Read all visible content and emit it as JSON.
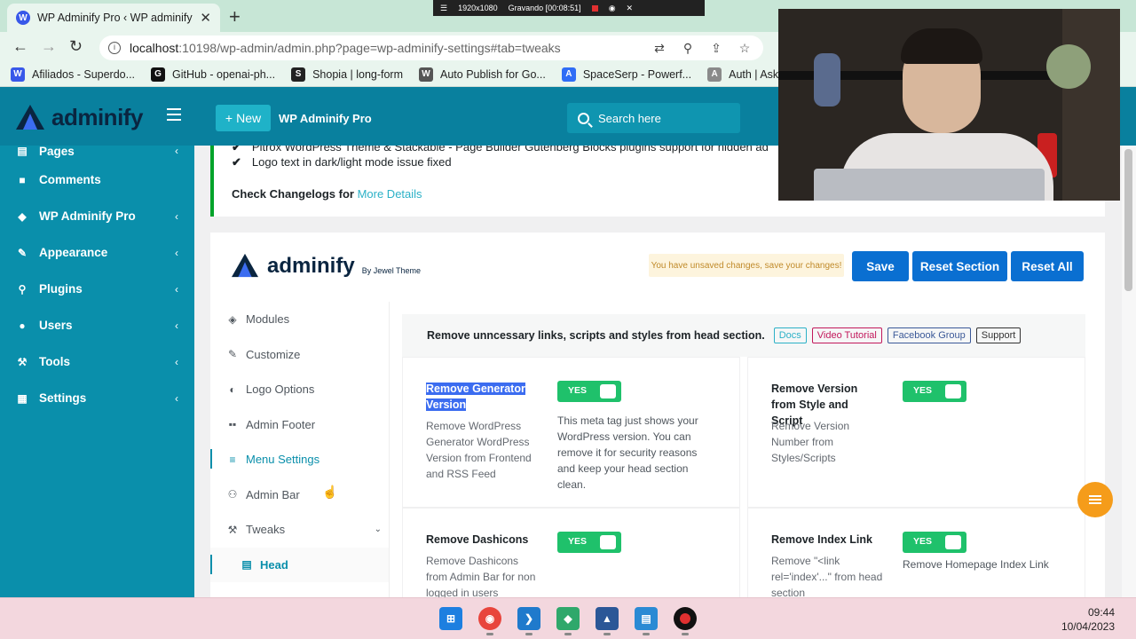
{
  "browser": {
    "tab_title": "WP Adminify Pro ‹ WP adminify",
    "tab_close": "✕",
    "new_tab": "+",
    "recorder": {
      "resolution": "1920x1080",
      "status": "Gravando [00:08:51]"
    },
    "url_host": "localhost",
    "url_rest": ":10198/wp-admin/admin.php?page=wp-adminify-settings#tab=tweaks",
    "bookmarks": [
      {
        "label": "Afiliados - Superdo...",
        "color": "#3858e9",
        "glyph": "W"
      },
      {
        "label": "GitHub - openai-ph...",
        "color": "#111111",
        "glyph": "G"
      },
      {
        "label": "Shopia | long-form",
        "color": "#222222",
        "glyph": "S"
      },
      {
        "label": "Auto Publish for Go...",
        "color": "#555555",
        "glyph": "W"
      },
      {
        "label": "SpaceSerp - Powerf...",
        "color": "#2f6df6",
        "glyph": "A"
      },
      {
        "label": "Auth | AskCodi",
        "color": "#8a8a8a",
        "glyph": "A"
      }
    ]
  },
  "adminbar": {
    "logo_text": "adminify",
    "new_label": "New",
    "site_name": "WP Adminify Pro",
    "search_placeholder": "Search here"
  },
  "sidebar": {
    "items": [
      {
        "label": "Pages",
        "icon": "pages-icon",
        "glyph": "▤",
        "chevron": true,
        "partial": true
      },
      {
        "label": "Comments",
        "icon": "comments-icon",
        "glyph": "■",
        "chevron": false
      },
      {
        "label": "WP Adminify Pro",
        "icon": "adminify-icon",
        "glyph": "◆",
        "chevron": true
      },
      {
        "label": "Appearance",
        "icon": "brush-icon",
        "glyph": "✎",
        "chevron": true
      },
      {
        "label": "Plugins",
        "icon": "plugin-icon",
        "glyph": "⚲",
        "chevron": true
      },
      {
        "label": "Users",
        "icon": "users-icon",
        "glyph": "●",
        "chevron": true
      },
      {
        "label": "Tools",
        "icon": "wrench-icon",
        "glyph": "⚒",
        "chevron": true
      },
      {
        "label": "Settings",
        "icon": "settings-icon",
        "glyph": "▦",
        "chevron": true
      }
    ]
  },
  "notice": {
    "line1": "Pitrox WordPress Theme & Stackable - Page Builder Gutenberg Blocks plugins support for hidden ad",
    "line2": "Logo text in dark/light mode issue fixed",
    "changelog_prefix": "Check Changelogs for ",
    "changelog_link": "More Details"
  },
  "panel": {
    "logo_text": "adminify",
    "by_text": "By Jewel Theme",
    "unsaved": "You have unsaved changes, save your changes!",
    "save": "Save",
    "reset_section": "Reset Section",
    "reset_all": "Reset All"
  },
  "subnav": [
    {
      "label": "Modules",
      "icon": "modules-icon",
      "glyph": "◈"
    },
    {
      "label": "Customize",
      "icon": "customize-icon",
      "glyph": "✎"
    },
    {
      "label": "Logo Options",
      "icon": "logo-options-icon",
      "glyph": "◐"
    },
    {
      "label": "Admin Footer",
      "icon": "footer-icon",
      "glyph": "▪▪"
    },
    {
      "label": "Menu Settings",
      "icon": "menu-icon",
      "glyph": "≡",
      "active": true
    },
    {
      "label": "Admin Bar",
      "icon": "admin-bar-icon",
      "glyph": "⚇"
    },
    {
      "label": "Tweaks",
      "icon": "tweaks-icon",
      "glyph": "⚒",
      "dropdown": true
    },
    {
      "label": "Head",
      "icon": "head-icon",
      "glyph": "▤",
      "child": true
    }
  ],
  "content": {
    "heading": "Remove unncessary links, scripts and styles from head section.",
    "tags": [
      {
        "label": "Docs",
        "color": "#2cb1c7"
      },
      {
        "label": "Video Tutorial",
        "color": "#c2185b"
      },
      {
        "label": "Facebook Group",
        "color": "#3b5998"
      },
      {
        "label": "Support",
        "color": "#333333"
      }
    ],
    "cards": [
      {
        "title": "Remove Generator Version",
        "desc": "Remove WordPress Generator WordPress Version from Frontend and RSS Feed",
        "toggle": "YES",
        "toggle_desc": "This meta tag just shows your WordPress version. You can remove it for security reasons and keep your head section clean.",
        "selected": true
      },
      {
        "title": "Remove Version from Style and Script",
        "desc": "Remove Version Number from Styles/Scripts",
        "toggle": "YES",
        "toggle_desc": ""
      },
      {
        "title": "Remove Dashicons",
        "desc": "Remove Dashicons from Admin Bar for non logged in users",
        "toggle": "YES",
        "toggle_desc": ""
      },
      {
        "title": "Remove Index Link",
        "desc": "Remove \"<link rel='index'...\" from head section",
        "toggle": "YES",
        "toggle_desc": "Remove Homepage Index Link"
      }
    ]
  },
  "taskbar": {
    "time": "09:44",
    "date": "10/04/2023"
  }
}
